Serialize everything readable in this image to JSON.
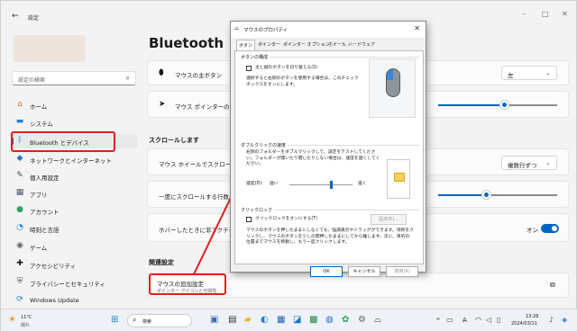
{
  "window": {
    "back_icon": "←",
    "title": "設定",
    "minimize": "–",
    "maximize": "□",
    "close": "✕"
  },
  "sidebar": {
    "search_placeholder": "設定の検索",
    "search_icon": "⌕",
    "items": [
      {
        "label": "ホーム",
        "icon": "⌂",
        "color": "#d76b2a"
      },
      {
        "label": "システム",
        "icon": "▬",
        "color": "#1b7fd4"
      },
      {
        "label": "Bluetooth とデバイス",
        "icon": "ᛒ",
        "color": "#1b7fd4"
      },
      {
        "label": "ネットワークとインターネット",
        "icon": "◆",
        "color": "#2a74c8"
      },
      {
        "label": "個人用設定",
        "icon": "✎",
        "color": "#444444"
      },
      {
        "label": "アプリ",
        "icon": "▦",
        "color": "#4a5a70"
      },
      {
        "label": "アカウント",
        "icon": "●",
        "color": "#2aa567"
      },
      {
        "label": "時刻と言語",
        "icon": "◔",
        "color": "#1b7fd4"
      },
      {
        "label": "ゲーム",
        "icon": "◉",
        "color": "#666666"
      },
      {
        "label": "アクセシビリティ",
        "icon": "✚",
        "color": "#1a1a1a"
      },
      {
        "label": "プライバシーとセキュリティ",
        "icon": "⛨",
        "color": "#555555"
      },
      {
        "label": "Windows Update",
        "icon": "⟳",
        "color": "#1b7fd4"
      }
    ]
  },
  "main": {
    "page_title": "Bluetooth とデバ",
    "rows": {
      "primary_button_label": "マウスの主ボタン",
      "primary_button_value": "左",
      "pointer_speed_label": "マウス ポインターの速",
      "scroll_section": "スクロールします",
      "wheel_scroll_label": "マウス ホイールでスクロールする",
      "wheel_scroll_value": "複数行ずつ",
      "lines_label": "一度にスクロールする行数",
      "hover_label": "ホバーしたときに非アクティブ",
      "hover_value": "オン",
      "related_section": "関連設定",
      "additional_settings": "マウスの追加設定",
      "additional_settings_sub": "ポインター アイコンと可視性"
    },
    "pointer_speed_level": 0.55,
    "lines_level": 0.4
  },
  "dialog": {
    "title": "マウスのプロパティ",
    "close": "✕",
    "tabs": [
      "ボタン",
      "ポインター",
      "ポインター オプション",
      "ホイール",
      "ハードウェア"
    ],
    "button_config_title": "ボタンの構成",
    "switch_label": "主と副のボタンを切り替える(S)",
    "switch_desc": "選択すると右側のボタンを使用する場合は、このチェック ボックスをオンにします。",
    "dbl_title": "ダブルクリックの速度",
    "dbl_desc": "右側のフォルダーをダブルクリックして、設定をテストしてください。フォルダーが開いたり閉じたりしない場合は、速度を遅くしてください。",
    "speed_label": "速度(D):",
    "slow": "遅い",
    "fast": "速く",
    "dbl_speed_level": 0.64,
    "clicklock_title": "クリックロック",
    "clicklock_label": "クリックロックをオンにする(T)",
    "settings_button": "設定(E)...",
    "clicklock_desc": "マウスのボタンを押したままにしなくても、強調表示やドラッグができます。項目をクリックし、マウスのボタンを少しの間押したままにしてから離します。次に、目的の位置までマウスを移動し、もう一度クリックします。",
    "ok": "OK",
    "cancel": "キャンセル",
    "apply": "適用(A)"
  },
  "taskbar": {
    "weather_temp": "11°C",
    "weather_desc": "晴れ",
    "search_label": "検索",
    "tray_chevron": "^",
    "ime": "A",
    "time": "13:26",
    "date": "2024/03/11"
  },
  "colors": {
    "accent": "#0067c0",
    "highlight_red": "#e01e1e"
  }
}
